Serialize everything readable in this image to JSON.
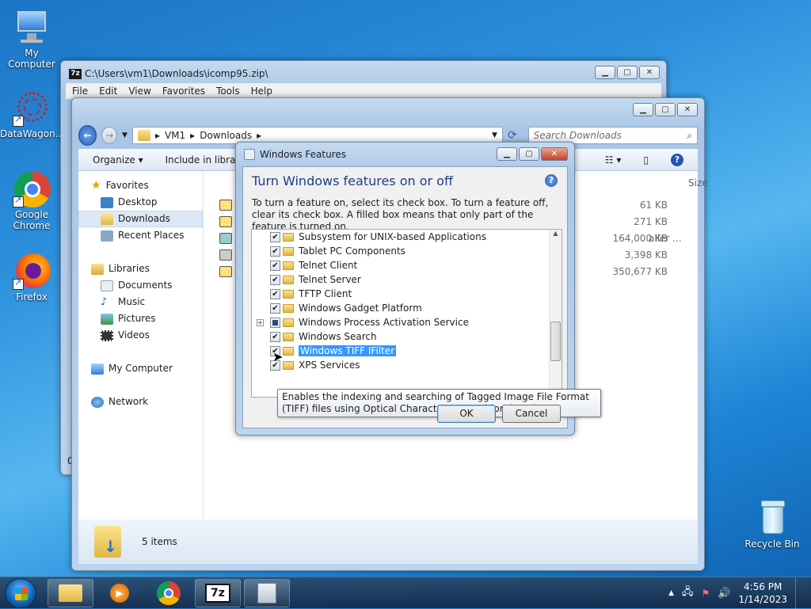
{
  "desktop": {
    "icons": [
      {
        "label": "My Computer"
      },
      {
        "label": "DataWagon..."
      },
      {
        "label": "Google Chrome"
      },
      {
        "label": "Firefox"
      },
      {
        "label": "Recycle Bin"
      }
    ]
  },
  "zip_window": {
    "title": "C:\\Users\\vm1\\Downloads\\icomp95.zip\\",
    "logo": "7z",
    "menu": [
      "File",
      "Edit",
      "View",
      "Favorites",
      "Tools",
      "Help"
    ],
    "status_fragment": "0"
  },
  "explorer": {
    "breadcrumb": [
      "VM1",
      "Downloads"
    ],
    "search_placeholder": "Search Downloads",
    "toolbar": {
      "organize": "Organize",
      "include": "Include in library"
    },
    "nav": {
      "favorites": "Favorites",
      "desktop": "Desktop",
      "downloads": "Downloads",
      "recent": "Recent Places",
      "libraries": "Libraries",
      "documents": "Documents",
      "music": "Music",
      "pictures": "Pictures",
      "videos": "Videos",
      "computer": "My Computer",
      "network": "Network"
    },
    "column_size": "Size",
    "files": [
      {
        "size": "61 KB",
        "type_frag": ""
      },
      {
        "size": "271 KB",
        "type_frag": ""
      },
      {
        "size": "164,000 KB",
        "type_frag": "aller ..."
      },
      {
        "size": "3,398 KB",
        "type_frag": ""
      },
      {
        "size": "350,677 KB",
        "type_frag": ""
      }
    ],
    "status": "5 items"
  },
  "features_dialog": {
    "title": "Windows Features",
    "heading": "Turn Windows features on or off",
    "description": "To turn a feature on, select its check box. To turn a feature off, clear its check box. A filled box means that only part of the feature is turned on.",
    "features": [
      {
        "label": "Subsystem for UNIX-based Applications",
        "state": "checked",
        "expandable": false
      },
      {
        "label": "Tablet PC Components",
        "state": "checked",
        "expandable": false
      },
      {
        "label": "Telnet Client",
        "state": "checked",
        "expandable": false
      },
      {
        "label": "Telnet Server",
        "state": "checked",
        "expandable": false
      },
      {
        "label": "TFTP Client",
        "state": "checked",
        "expandable": false
      },
      {
        "label": "Windows Gadget Platform",
        "state": "checked",
        "expandable": false
      },
      {
        "label": "Windows Process Activation Service",
        "state": "partial",
        "expandable": true
      },
      {
        "label": "Windows Search",
        "state": "checked",
        "expandable": false
      },
      {
        "label": "Windows TIFF IFilter",
        "state": "checked",
        "expandable": false,
        "selected": true
      },
      {
        "label": "XPS Services",
        "state": "checked",
        "expandable": false
      }
    ],
    "tooltip": "Enables the indexing and searching of Tagged Image File Format (TIFF) files using Optical Character Recognition (OCR).",
    "ok": "OK",
    "cancel": "Cancel"
  },
  "taskbar": {
    "time": "4:56 PM",
    "date": "1/14/2023",
    "zip_label": "7z"
  },
  "colors": {
    "accent": "#3399ff",
    "heading_blue": "#1e3d8a"
  }
}
